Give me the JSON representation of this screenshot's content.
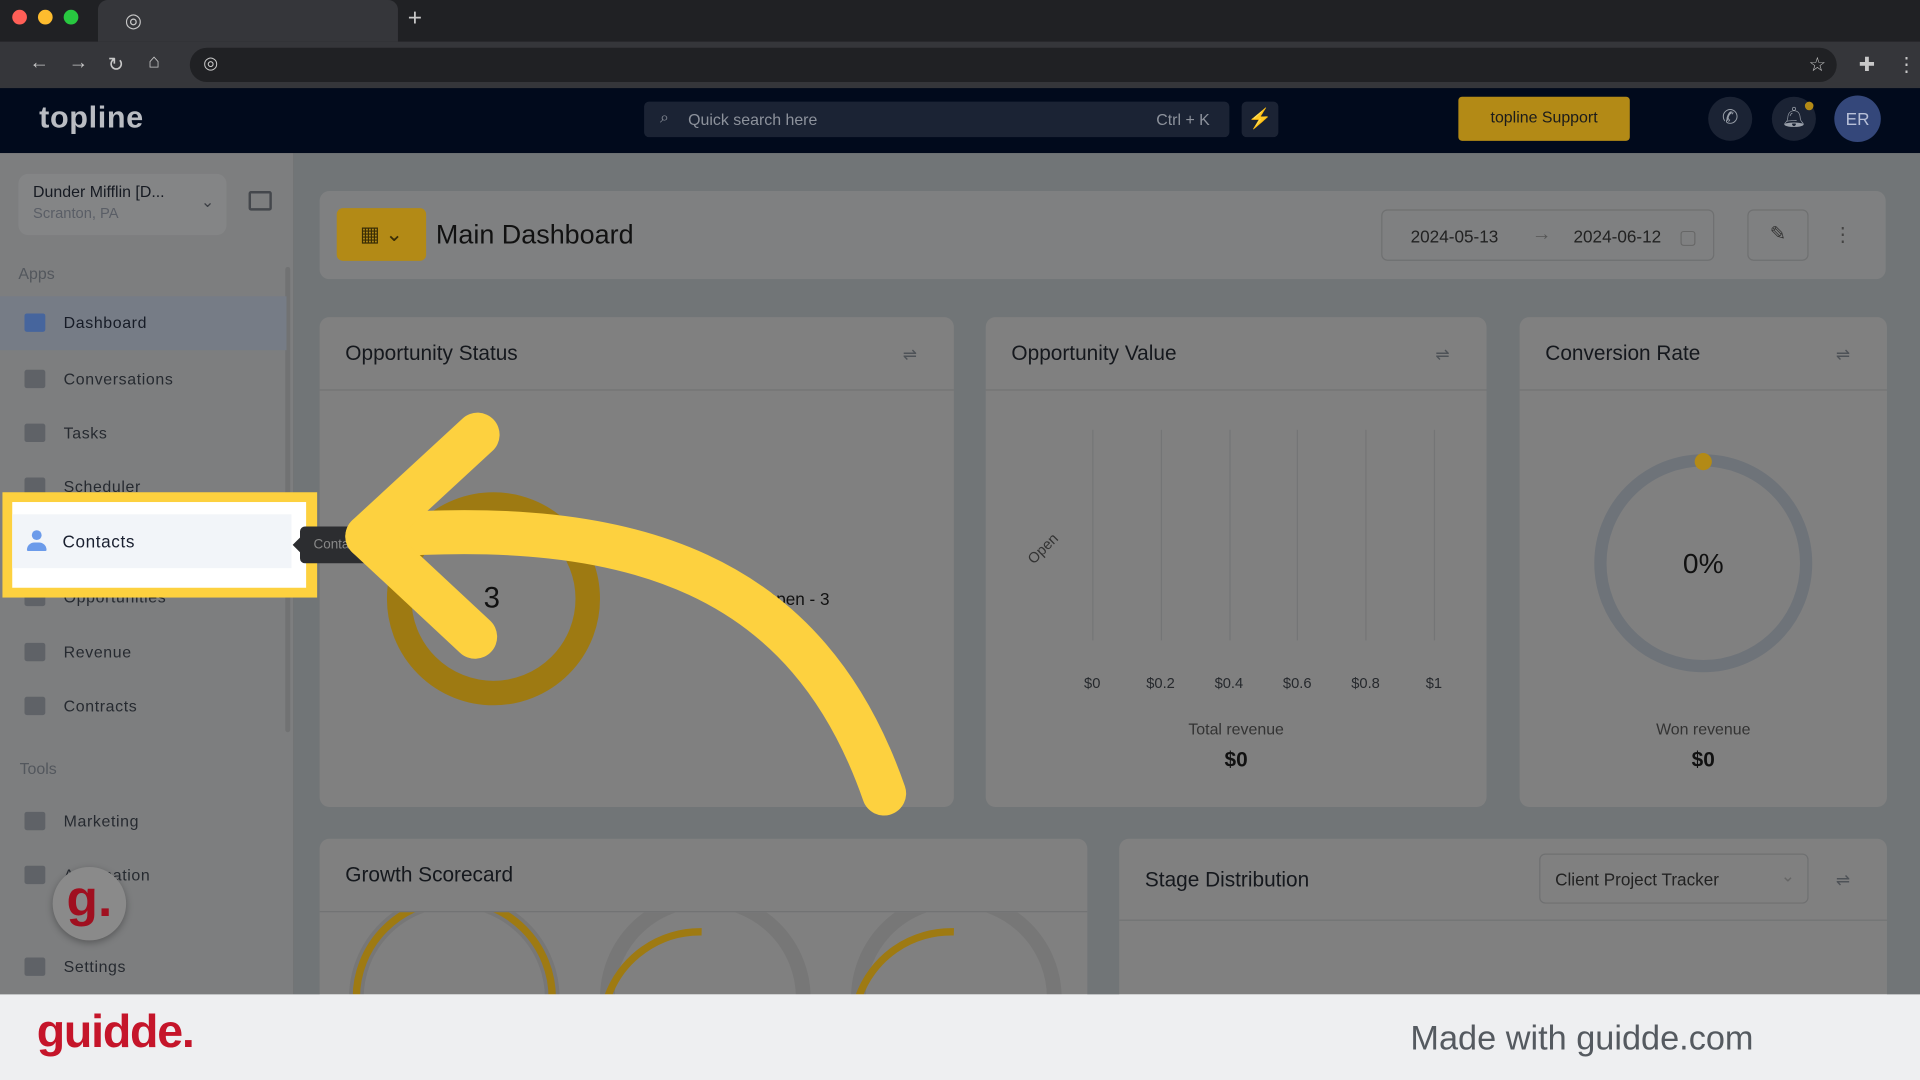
{
  "browser": {
    "new_tab": "+"
  },
  "app": {
    "logo": "topline",
    "search_placeholder": "Quick search here",
    "search_shortcut": "Ctrl + K",
    "support_label": "topline Support",
    "avatar_initials": "ER"
  },
  "org": {
    "name": "Dunder Mifflin [D...",
    "location": "Scranton, PA"
  },
  "sidebar": {
    "apps_label": "Apps",
    "items": [
      {
        "label": "Dashboard"
      },
      {
        "label": "Conversations"
      },
      {
        "label": "Tasks"
      },
      {
        "label": "Scheduler"
      },
      {
        "label": "Contacts"
      },
      {
        "label": "Opportunities"
      },
      {
        "label": "Revenue"
      },
      {
        "label": "Contracts"
      }
    ],
    "tools_label": "Tools",
    "tools": [
      {
        "label": "Marketing"
      },
      {
        "label": "Automation"
      },
      {
        "label": "Settings"
      }
    ],
    "tooltip": "Contacts"
  },
  "dashboard": {
    "title": "Main Dashboard",
    "date_start": "2024-05-13",
    "date_end": "2024-06-12"
  },
  "opportunity_status": {
    "title": "Opportunity Status",
    "center_value": "3",
    "legend": "Open - 3"
  },
  "opportunity_value": {
    "title": "Opportunity Value",
    "category": "Open",
    "ticks": [
      "$0",
      "$0.2",
      "$0.4",
      "$0.6",
      "$0.8",
      "$1"
    ],
    "total_label": "Total revenue",
    "total_value": "$0"
  },
  "conversion_rate": {
    "title": "Conversion Rate",
    "value": "0%",
    "won_label": "Won revenue",
    "won_value": "$0"
  },
  "growth": {
    "title": "Growth Scorecard"
  },
  "stage": {
    "title": "Stage Distribution",
    "pipeline": "Client Project Tracker"
  },
  "chart_data": {
    "type": "bar",
    "categories": [
      "Open"
    ],
    "values": [
      0
    ],
    "xlim": [
      0,
      1
    ],
    "ticks": [
      "$0",
      "$0.2",
      "$0.4",
      "$0.6",
      "$0.8",
      "$1"
    ]
  },
  "footer": {
    "brand": "guidde.",
    "made_with": "Made with guidde.com"
  },
  "colors": {
    "highlight": "#fdd13f",
    "accent": "#b38a16",
    "brand": "#c5152a"
  }
}
